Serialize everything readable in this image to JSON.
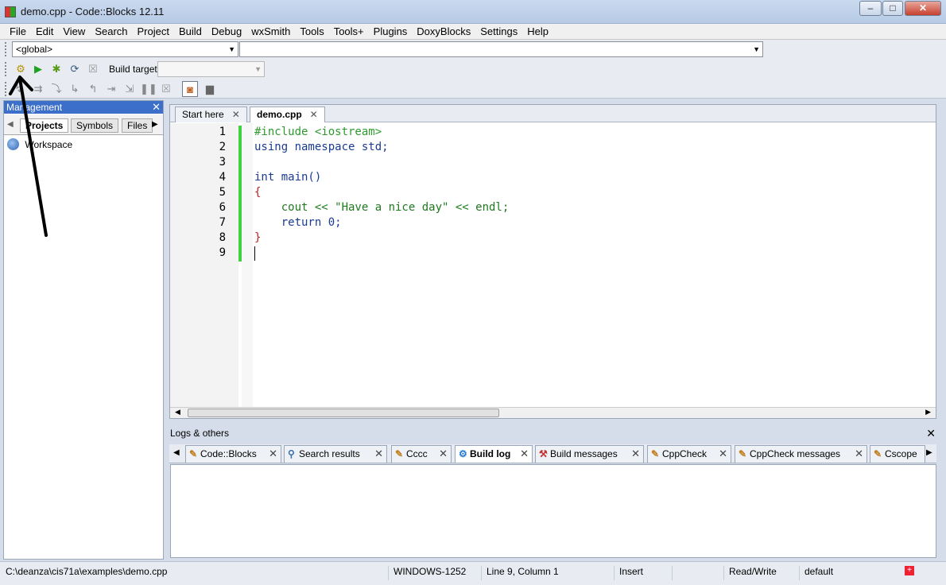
{
  "window": {
    "title": "demo.cpp - Code::Blocks 12.11",
    "minimize": "‒",
    "maximize": "□",
    "close": "✕"
  },
  "menu": [
    "File",
    "Edit",
    "View",
    "Search",
    "Project",
    "Build",
    "Debug",
    "wxSmith",
    "Tools",
    "Tools+",
    "Plugins",
    "DoxyBlocks",
    "Settings",
    "Help"
  ],
  "scope": {
    "global": "<global>",
    "symbol": ""
  },
  "toolbar": {
    "build_target_label": "Build target:",
    "build_target_value": ""
  },
  "management": {
    "title": "Management",
    "tabs": [
      "Projects",
      "Symbols",
      "Files"
    ],
    "tree": {
      "workspace": "Workspace"
    }
  },
  "editor": {
    "tabs": [
      {
        "label": "Start here"
      },
      {
        "label": "demo.cpp"
      }
    ],
    "line_numbers": [
      "1",
      "2",
      "3",
      "4",
      "5",
      "6",
      "7",
      "8",
      "9"
    ],
    "lines": [
      "#include <iostream>",
      "using namespace std;",
      "",
      "int main()",
      "{",
      "    cout << \"Have a nice day\" << endl;",
      "    return 0;",
      "}",
      ""
    ]
  },
  "logs": {
    "title": "Logs & others",
    "tabs": [
      "Code::Blocks",
      "Search results",
      "Cccc",
      "Build log",
      "Build messages",
      "CppCheck",
      "CppCheck messages",
      "Cscope"
    ]
  },
  "status": {
    "path": "C:\\deanza\\cis71a\\examples\\demo.cpp",
    "encoding": "WINDOWS-1252",
    "position": "Line 9, Column 1",
    "mode": "Insert",
    "access": "Read/Write",
    "profile": "default"
  },
  "colors": {
    "accent": "#3b6fc9",
    "changebar": "#3fd13f",
    "arrow": "#000000"
  }
}
